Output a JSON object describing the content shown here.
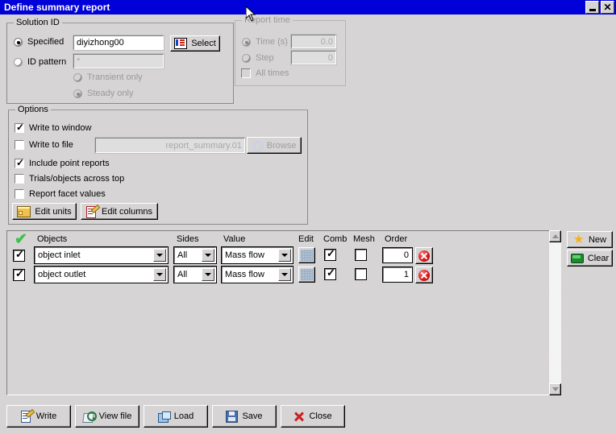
{
  "window": {
    "title": "Define summary report",
    "minimize_label": "minimize",
    "close_label": "close"
  },
  "solution_id": {
    "group_title": "Solution ID",
    "specified_label": "Specified",
    "specified_selected": true,
    "specified_value": "diyizhong00",
    "select_button": "Select",
    "id_pattern_label": "ID pattern",
    "id_pattern_value": "*",
    "transient_label": "Transient only",
    "steady_label": "Steady only"
  },
  "report_time": {
    "group_title": "Report time",
    "time_label": "Time (s)",
    "time_value": "0.0",
    "step_label": "Step",
    "step_value": "0",
    "all_times_label": "All times"
  },
  "options": {
    "group_title": "Options",
    "write_to_window_label": "Write to window",
    "write_to_file_label": "Write to file",
    "file_value": "report_summary.01",
    "browse_button": "Browse",
    "include_point_reports_label": "Include point reports",
    "trials_objects_label": "Trials/objects across top",
    "report_facet_label": "Report facet values",
    "edit_units_button": "Edit units",
    "edit_columns_button": "Edit columns"
  },
  "grid": {
    "headers": {
      "check": "",
      "objects": "Objects",
      "sides": "Sides",
      "value": "Value",
      "edit": "Edit",
      "comb": "Comb",
      "mesh": "Mesh",
      "order": "Order"
    },
    "rows": [
      {
        "checked": true,
        "object": "object inlet",
        "sides": "All",
        "value": "Mass flow",
        "comb": true,
        "mesh": false,
        "order": "0"
      },
      {
        "checked": true,
        "object": "object outlet",
        "sides": "All",
        "value": "Mass flow",
        "comb": true,
        "mesh": false,
        "order": "1"
      }
    ],
    "new_button": "New",
    "clear_button": "Clear"
  },
  "footer": {
    "write_button": "Write",
    "view_file_button": "View file",
    "load_button": "Load",
    "save_button": "Save",
    "close_button": "Close"
  },
  "colors": {
    "titlebar": "#0000d8",
    "face": "#d6d4d4",
    "disabled_text": "#9a9a9a",
    "accent_green": "#3ac24a",
    "accent_red": "#d81818"
  }
}
